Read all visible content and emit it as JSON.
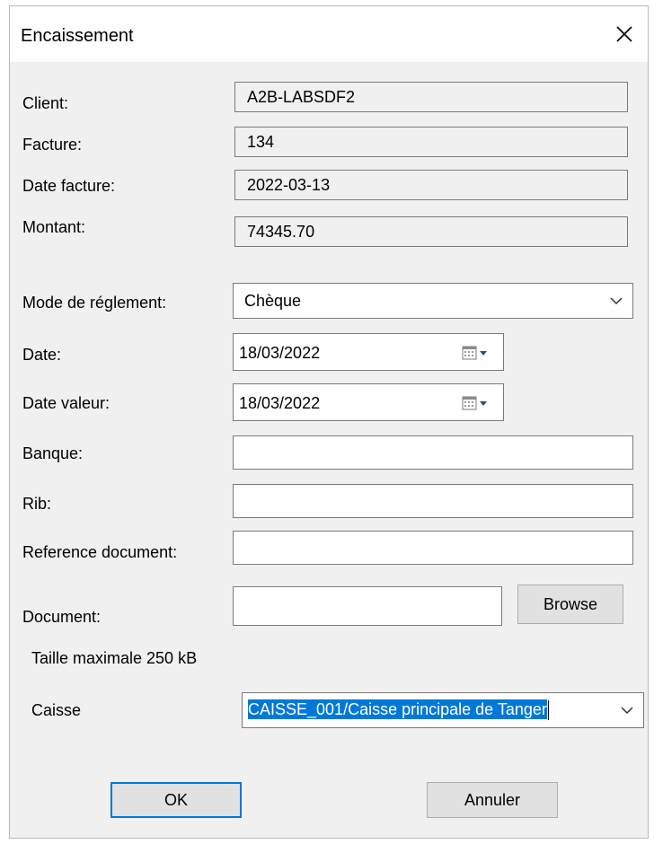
{
  "window": {
    "title": "Encaissement"
  },
  "info": {
    "client_label": "Client:",
    "client_value": "A2B-LABSDF2",
    "facture_label": "Facture:",
    "facture_value": "134",
    "date_facture_label": "Date facture:",
    "date_facture_value": "2022-03-13",
    "montant_label": "Montant:",
    "montant_value": "74345.70"
  },
  "form": {
    "mode_label": "Mode de réglement:",
    "mode_value": "Chèque",
    "date_label": "Date:",
    "date_value": "18/03/2022",
    "date_valeur_label": "Date valeur:",
    "date_valeur_value": "18/03/2022",
    "banque_label": "Banque:",
    "banque_value": "",
    "rib_label": "Rib:",
    "rib_value": "",
    "reference_label": "Reference document:",
    "reference_value": "",
    "document_label": "Document:",
    "document_value": "",
    "browse_label": "Browse",
    "taille_note": "Taille maximale 250 kB",
    "caisse_label": "Caisse",
    "caisse_value": "CAISSE_001/Caisse principale de Tanger"
  },
  "buttons": {
    "ok_label": "OK",
    "cancel_label": "Annuler"
  },
  "colors": {
    "window_bg": "#f0f0f0",
    "title_bg": "#ffffff",
    "accent": "#0078d7",
    "button_bg": "#e1e1e1"
  },
  "icons": {
    "close": "close-icon",
    "dropdown": "chevron-down-icon",
    "calendar": "calendar-icon"
  }
}
